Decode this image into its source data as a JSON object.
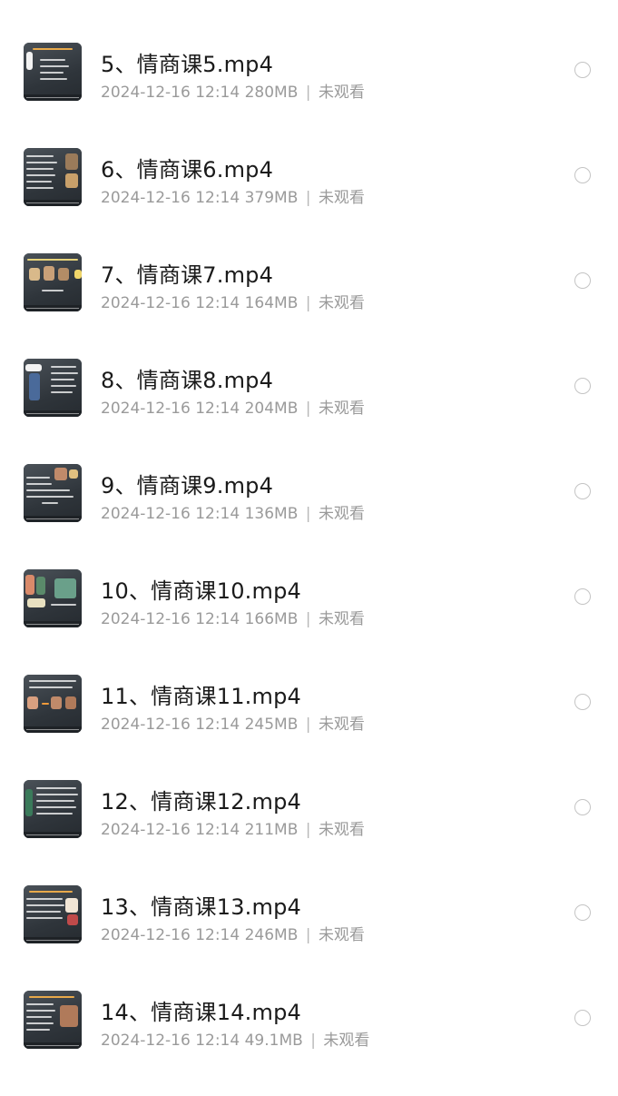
{
  "files": [
    {
      "title": "5、情商课5.mp4",
      "date": "2024-12-16 12:14",
      "size": "280MB",
      "status": "未观看",
      "thumb_icon": "video-thumbnail-icon"
    },
    {
      "title": "6、情商课6.mp4",
      "date": "2024-12-16 12:14",
      "size": "379MB",
      "status": "未观看",
      "thumb_icon": "video-thumbnail-icon"
    },
    {
      "title": "7、情商课7.mp4",
      "date": "2024-12-16 12:14",
      "size": "164MB",
      "status": "未观看",
      "thumb_icon": "video-thumbnail-icon"
    },
    {
      "title": "8、情商课8.mp4",
      "date": "2024-12-16 12:14",
      "size": "204MB",
      "status": "未观看",
      "thumb_icon": "video-thumbnail-icon"
    },
    {
      "title": "9、情商课9.mp4",
      "date": "2024-12-16 12:14",
      "size": "136MB",
      "status": "未观看",
      "thumb_icon": "video-thumbnail-icon"
    },
    {
      "title": "10、情商课10.mp4",
      "date": "2024-12-16 12:14",
      "size": "166MB",
      "status": "未观看",
      "thumb_icon": "video-thumbnail-icon"
    },
    {
      "title": "11、情商课11.mp4",
      "date": "2024-12-16 12:14",
      "size": "245MB",
      "status": "未观看",
      "thumb_icon": "video-thumbnail-icon"
    },
    {
      "title": "12、情商课12.mp4",
      "date": "2024-12-16 12:14",
      "size": "211MB",
      "status": "未观看",
      "thumb_icon": "video-thumbnail-icon"
    },
    {
      "title": "13、情商课13.mp4",
      "date": "2024-12-16 12:14",
      "size": "246MB",
      "status": "未观看",
      "thumb_icon": "video-thumbnail-icon"
    },
    {
      "title": "14、情商课14.mp4",
      "date": "2024-12-16 12:14",
      "size": "49.1MB",
      "status": "未观看",
      "thumb_icon": "video-thumbnail-icon"
    }
  ],
  "meta_separator": "|",
  "colors": {
    "title": "#1a1a1a",
    "meta": "#9a9a9a",
    "radio_border": "#c4c4c4",
    "thumbnail_board": "#3a4148"
  }
}
